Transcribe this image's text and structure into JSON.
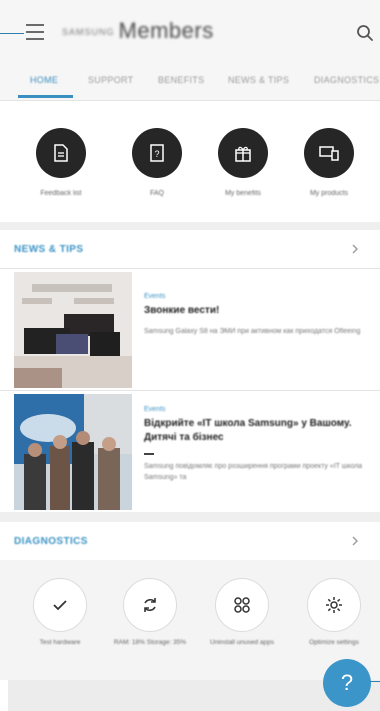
{
  "header": {
    "brand": "SAMSUNG",
    "title": "Members",
    "search_icon": "search-icon",
    "menu_icon": "hamburger-menu-icon"
  },
  "tabs": [
    {
      "label": "HOME",
      "active": true
    },
    {
      "label": "SUPPORT",
      "active": false
    },
    {
      "label": "BENEFITS",
      "active": false
    },
    {
      "label": "NEWS & TIPS",
      "active": false
    },
    {
      "label": "DIAGNOSTICS",
      "active": false
    }
  ],
  "quick_actions": [
    {
      "label": "Feedback list",
      "icon": "document-icon"
    },
    {
      "label": "FAQ",
      "icon": "faq-icon"
    },
    {
      "label": "My benefits",
      "icon": "gift-icon"
    },
    {
      "label": "My products",
      "icon": "devices-icon"
    }
  ],
  "news_section": {
    "title": "NEWS & TIPS",
    "items": [
      {
        "category": "Events",
        "title": "Звонкие вести!",
        "description": "Samsung Galaxy S8 на ЭМИ при активном как приходатся Ofleeing"
      },
      {
        "category": "Events",
        "title": "Відкрийте «IT школа Samsung» у Вашому. Дитячі та бізнес",
        "description": "Samsung повідомляє про розширення програми проекту «IT школа Samsung» та"
      }
    ]
  },
  "diagnostics_section": {
    "title": "DIAGNOSTICS",
    "items": [
      {
        "label": "Test hardware",
        "icon": "check-icon"
      },
      {
        "label": "RAM: 18% Storage: 35%",
        "icon": "refresh-icon"
      },
      {
        "label": "Uninstall unused apps",
        "icon": "apps-grid-icon"
      },
      {
        "label": "Optimize settings",
        "icon": "gear-icon"
      }
    ]
  },
  "help_button": {
    "label": "?",
    "icon": "help-icon"
  },
  "colors": {
    "accent": "#3a93c4",
    "dark_circle": "#262626",
    "background": "#f6f6f6"
  }
}
